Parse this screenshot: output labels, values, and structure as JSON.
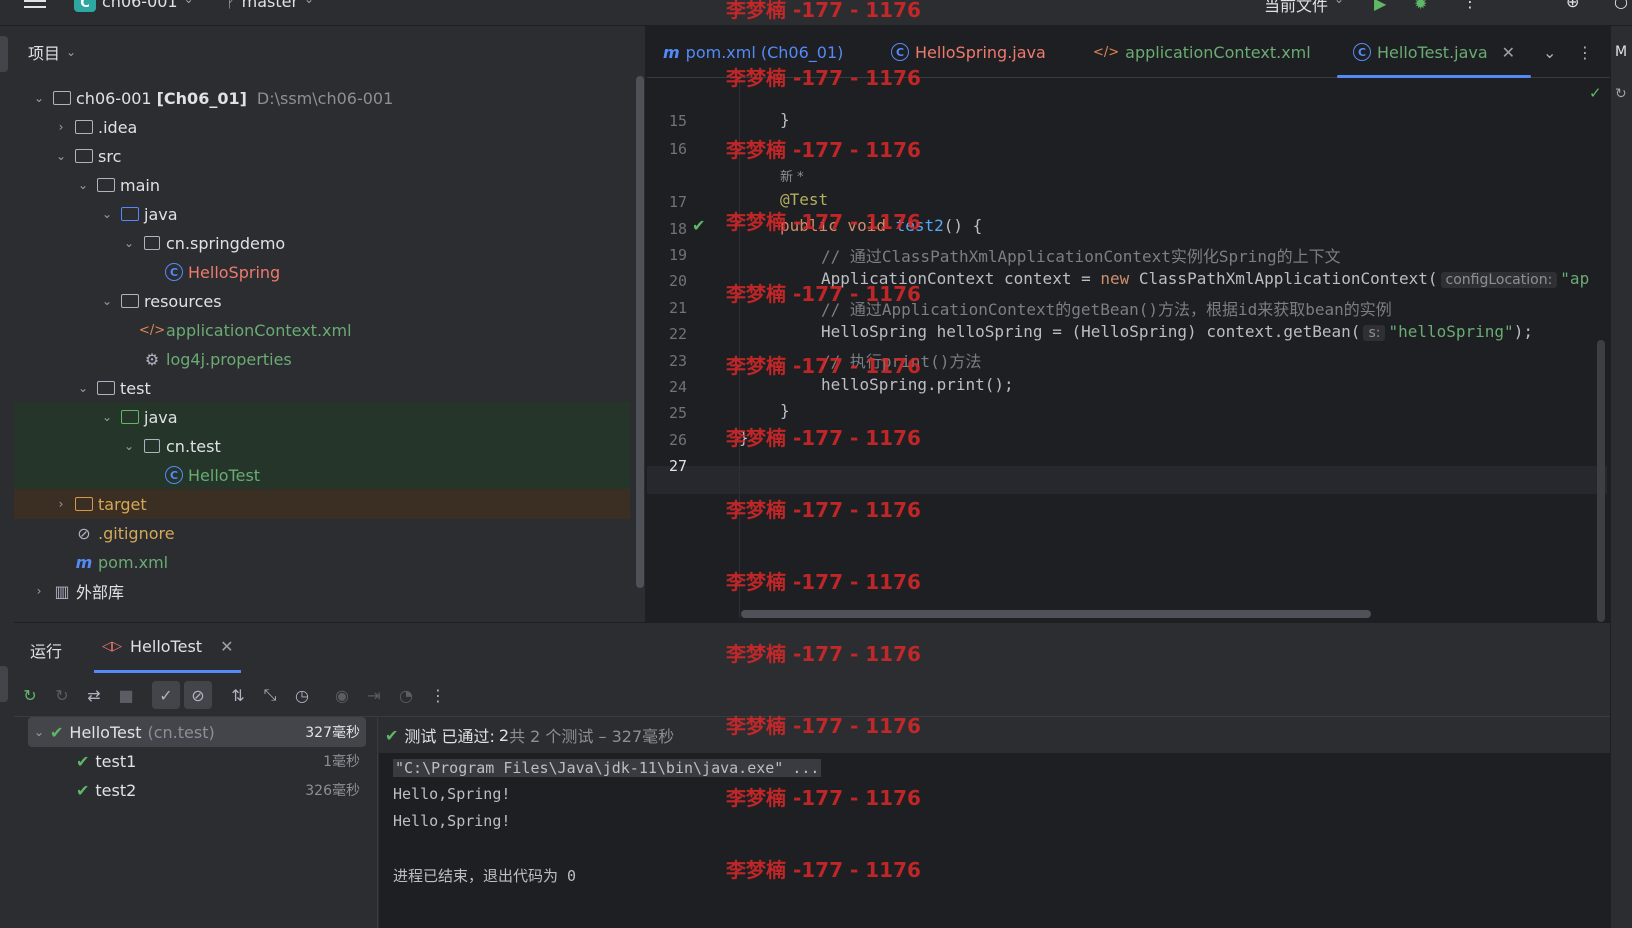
{
  "topbar": {
    "project_badge": "C",
    "project_name": "ch06-001",
    "branch": "master",
    "run_config": "当前文件"
  },
  "project_panel": {
    "title": "项目",
    "tree": [
      {
        "label": "ch06-001",
        "bold_suffix": "[Ch06_01]",
        "path": "D:\\ssm\\ch06-001"
      },
      {
        "label": ".idea"
      },
      {
        "label": "src"
      },
      {
        "label": "main"
      },
      {
        "label": "java"
      },
      {
        "label": "cn.springdemo"
      },
      {
        "label": "HelloSpring"
      },
      {
        "label": "resources"
      },
      {
        "label": "applicationContext.xml"
      },
      {
        "label": "log4j.properties"
      },
      {
        "label": "test"
      },
      {
        "label": "java"
      },
      {
        "label": "cn.test"
      },
      {
        "label": "HelloTest"
      },
      {
        "label": "target"
      },
      {
        "label": ".gitignore"
      },
      {
        "label": "pom.xml"
      },
      {
        "label": "外部库"
      }
    ]
  },
  "editor": {
    "tabs": [
      {
        "label": "pom.xml (Ch06_01)"
      },
      {
        "label": "HelloSpring.java"
      },
      {
        "label": "applicationContext.xml"
      },
      {
        "label": "HelloTest.java"
      }
    ],
    "line_numbers": [
      "15",
      "16",
      "17",
      "18",
      "19",
      "20",
      "21",
      "22",
      "23",
      "24",
      "25",
      "26",
      "27"
    ],
    "lines": {
      "l15": "}",
      "new_hint": "新 *",
      "l17": "@Test",
      "l18_kw": "public void ",
      "l18_fn": "test2",
      "l18_rest": "() {",
      "l19": "// 通过ClassPathXmlApplicationContext实例化Spring的上下文",
      "l20_a": "ApplicationContext context = ",
      "l20_kw": "new",
      "l20_b": " ClassPathXmlApplicationContext(",
      "l20_hint": "configLocation:",
      "l20_str": "\"ap",
      "l21": "// 通过ApplicationContext的getBean()方法，根据id来获取bean的实例",
      "l22_a": "HelloSpring helloSpring = (HelloSpring) context.getBean(",
      "l22_hint": "s:",
      "l22_str": "\"helloSpring\"",
      "l22_b": ");",
      "l23": "// 执行print()方法",
      "l24": "helloSpring.print();",
      "l25": "}",
      "l26": "}"
    }
  },
  "run_panel": {
    "tab_run": "运行",
    "tab_config": "HelloTest",
    "tests": [
      {
        "name": "HelloTest",
        "pkg": "(cn.test)",
        "duration": "327毫秒"
      },
      {
        "name": "test1",
        "duration": "1毫秒"
      },
      {
        "name": "test2",
        "duration": "326毫秒"
      }
    ],
    "status_prefix": "测试 已通过:",
    "status_count": "2",
    "status_suffix": "共 2 个测试 – 327毫秒",
    "console": [
      "\"C:\\Program Files\\Java\\jdk-11\\bin\\java.exe\" ...",
      "Hello,Spring!",
      "Hello,Spring!",
      "",
      "进程已结束，退出代码为 0"
    ]
  },
  "watermark": "李梦楠 -177 - 1176",
  "colors": {
    "accent": "#548af7",
    "pass": "#5fb865",
    "watermark": "#dc2828"
  }
}
